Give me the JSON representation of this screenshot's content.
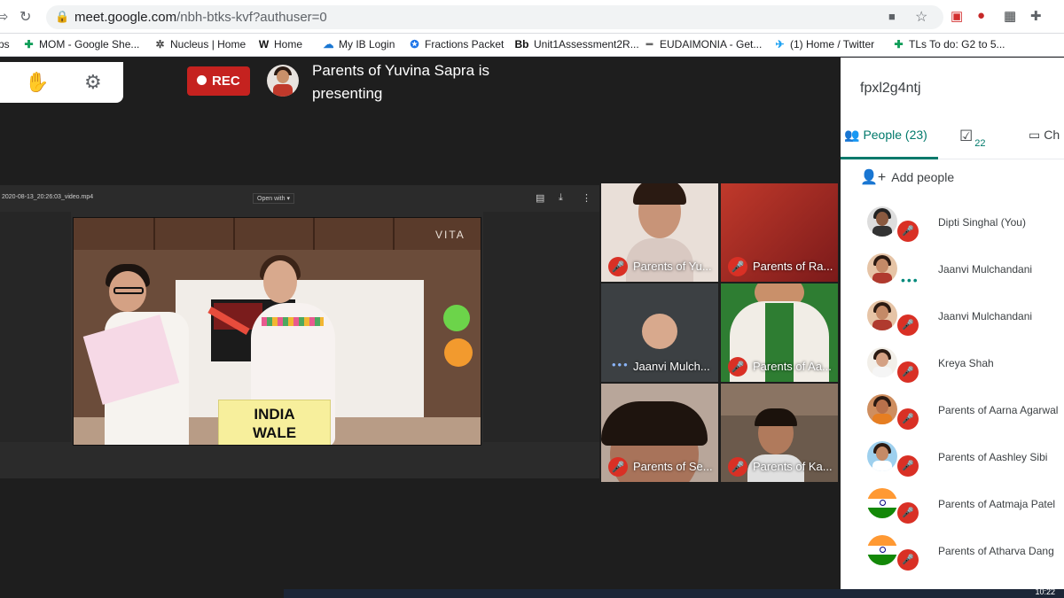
{
  "browser": {
    "url_host": "meet.google.com",
    "url_path": "/nbh-btks-kvf?authuser=0"
  },
  "bookmarks": [
    {
      "label": "ps",
      "icon": "apps-icon"
    },
    {
      "label": "MOM - Google She...",
      "icon": "sheets-icon"
    },
    {
      "label": "Nucleus | Home",
      "icon": "gear-icon"
    },
    {
      "label": "Home",
      "icon": "w-icon"
    },
    {
      "label": "My IB Login",
      "icon": "cloud-icon"
    },
    {
      "label": "Fractions Packet",
      "icon": "compass-icon"
    },
    {
      "label": "Unit1Assessment2R...",
      "icon": "bb-icon"
    },
    {
      "label": "EUDAIMONIA - Get...",
      "icon": "dash-icon"
    },
    {
      "label": "(1) Home / Twitter",
      "icon": "twitter-icon"
    },
    {
      "label": "TLs To do: G2 to 5...",
      "icon": "sheets-icon"
    }
  ],
  "meeting": {
    "rec_label": "REC",
    "presenting_text": "Parents of Yuvina Sapra is presenting",
    "code": "fpxl2g4ntj"
  },
  "shared_screen": {
    "file_name": "2020-08-13_20:26:03_video.mp4",
    "open_with": "Open with ▾",
    "brand": "VITA",
    "sign_line1": "INDIA",
    "sign_line2": "WALE"
  },
  "tiles": [
    {
      "label": "Parents of Yu..."
    },
    {
      "label": "Parents of Ra..."
    },
    {
      "label": "Jaanvi Mulch..."
    },
    {
      "label": "Parents of Aa..."
    },
    {
      "label": "Parents of Se..."
    },
    {
      "label": "Parents of Ka..."
    }
  ],
  "side_panel": {
    "people_tab": "People (23)",
    "tasks_count": "22",
    "chat_tab": "Ch",
    "add_people": "Add people",
    "people": [
      {
        "name": "Dipti Singhal (You)"
      },
      {
        "name": "Jaanvi Mulchandani"
      },
      {
        "name": "Jaanvi Mulchandani"
      },
      {
        "name": "Kreya Shah"
      },
      {
        "name": "Parents of Aarna Agarwal"
      },
      {
        "name": "Parents of Aashley Sibi"
      },
      {
        "name": "Parents of Aatmaja Patel"
      },
      {
        "name": "Parents of Atharva Dang"
      }
    ]
  },
  "taskbar": {
    "time": "10:22"
  }
}
